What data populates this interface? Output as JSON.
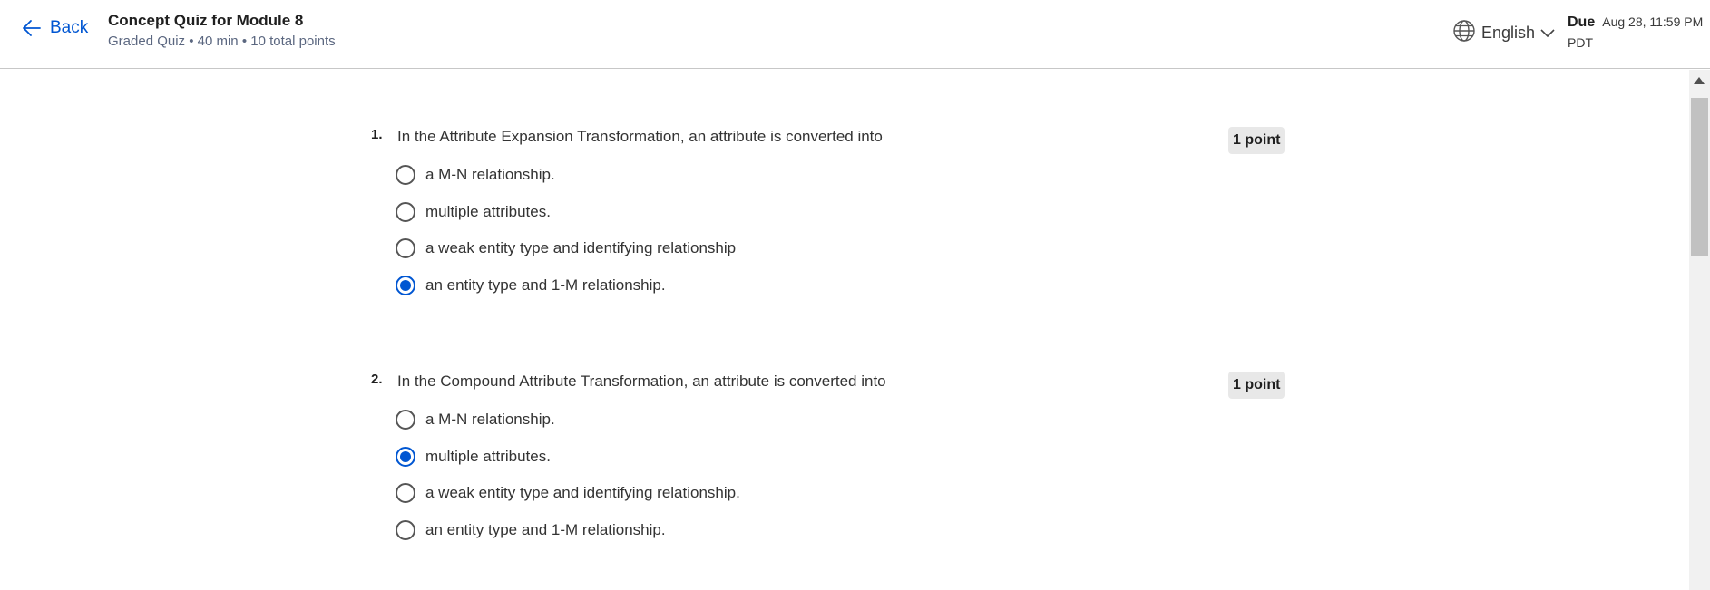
{
  "header": {
    "back_label": "Back",
    "title": "Concept Quiz for Module 8",
    "meta": "Graded Quiz • 40 min • 10 total points",
    "language": "English",
    "due_label": "Due",
    "due_date": "Aug 28, 11:59 PM",
    "due_tz": "PDT"
  },
  "questions": [
    {
      "number": "1.",
      "text": "In the Attribute Expansion Transformation, an attribute is converted into",
      "points": "1 point",
      "options": [
        "a M-N relationship.",
        "multiple attributes.",
        "a weak entity type and identifying relationship",
        "an entity type and 1-M relationship."
      ],
      "selected_index": 3
    },
    {
      "number": "2.",
      "text": "In the Compound Attribute Transformation, an attribute is converted into",
      "points": "1 point",
      "options": [
        "a M-N relationship.",
        "multiple attributes.",
        "a weak entity type and identifying relationship.",
        "an entity type and 1-M relationship."
      ],
      "selected_index": 1
    }
  ],
  "icons": {
    "back": "arrow-left-icon",
    "language": "globe-icon",
    "dropdown": "chevron-down-icon"
  },
  "colors": {
    "accent": "#0056d2",
    "points_badge_bg": "#e8e8e8"
  }
}
